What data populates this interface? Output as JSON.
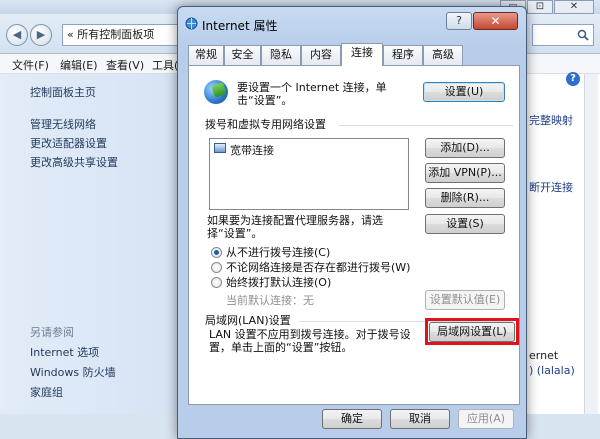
{
  "background_window": {
    "window_controls": {
      "minimize": "▭",
      "maximize": "⊡",
      "close": "✕"
    },
    "back_label": "◀",
    "forward_label": "▶",
    "address_chevron": "«",
    "address_text": "所有控制面板项",
    "menu": [
      "文件(F)",
      "编辑(E)",
      "查看(V)",
      "工具("
    ],
    "sidebar": {
      "home_link": "控制面板主页",
      "links": [
        "管理无线网络",
        "更改适配器设置",
        "更改高级共享设置"
      ],
      "see_also_label": "另请参阅",
      "see_also_links": [
        "Internet 选项",
        "Windows 防火墙",
        "家庭组"
      ]
    },
    "right_fragments": {
      "map_drive": "完整映射",
      "disconnect": "断开连接",
      "ernet": "ernet",
      "lalala": ") (lalala)"
    }
  },
  "dialog": {
    "title": "Internet 属性",
    "help_label": "?",
    "close_label": "✕",
    "tabs": [
      "常规",
      "安全",
      "隐私",
      "内容",
      "连接",
      "程序",
      "高级"
    ],
    "active_tab": "连接",
    "setup_text": "要设置一个 Internet 连接，单击“设置”。",
    "setup_button": "设置(U)",
    "dialup_group_label": "拨号和虚拟专用网络设置",
    "connections": [
      "宽带连接"
    ],
    "add_button": "添加(D)...",
    "add_vpn_button": "添加 VPN(P)...",
    "remove_button": "删除(R)...",
    "proxy_text": "如果要为连接配置代理服务器，请选择“设置”。",
    "settings_button": "设置(S)",
    "radio_options": [
      {
        "label": "从不进行拨号连接(C)",
        "checked": true
      },
      {
        "label": "不论网络连接是否存在都进行拨号(W)",
        "checked": false
      },
      {
        "label": "始终拨打默认连接(O)",
        "checked": false
      }
    ],
    "current_default_label": "当前默认连接：",
    "current_default_value": "无",
    "set_default_button": "设置默认值(E)",
    "lan_group_label": "局域网(LAN)设置",
    "lan_text": "LAN 设置不应用到拨号连接。对于拨号设置，单击上面的“设置”按钮。",
    "lan_settings_button": "局域网设置(L)",
    "ok_button": "确定",
    "cancel_button": "取消",
    "apply_button": "应用(A)",
    "highlight_color": "#e2121a"
  }
}
